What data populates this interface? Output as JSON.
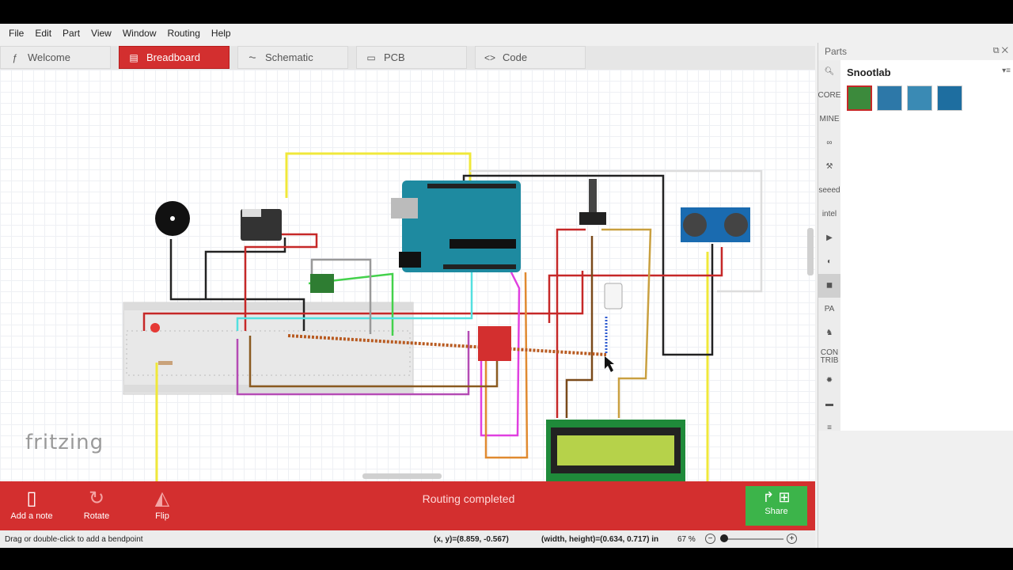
{
  "menu": [
    "File",
    "Edit",
    "Part",
    "View",
    "Window",
    "Routing",
    "Help"
  ],
  "tabs": [
    {
      "label": "Welcome",
      "icon": "f-icon"
    },
    {
      "label": "Breadboard",
      "icon": "breadboard-icon",
      "active": true
    },
    {
      "label": "Schematic",
      "icon": "schematic-icon"
    },
    {
      "label": "PCB",
      "icon": "pcb-icon"
    },
    {
      "label": "Code",
      "icon": "code-icon"
    }
  ],
  "canvas": {
    "logo_text": "fritzing"
  },
  "toolbar": {
    "add_note": "Add a note",
    "rotate": "Rotate",
    "flip": "Flip",
    "status": "Routing completed",
    "share": "Share"
  },
  "statusbar": {
    "hint": "Drag or double-click to add a bendpoint",
    "coords": "(x, y)=(8.859, -0.567)",
    "dims": "(width, height)=(0.634, 0.717) in",
    "zoom": "67 %"
  },
  "parts": {
    "title": "Parts",
    "bin_title": "Snootlab",
    "bins": [
      "CORE",
      "MINE",
      "∞",
      "⚒",
      "seeed",
      "intel",
      "▶",
      "◐",
      "◼",
      "PA",
      "♞",
      "CON TRIB",
      "✹",
      "▬",
      "≡"
    ]
  },
  "colors": {
    "accent": "#d32f2f",
    "share": "#3cb44a"
  }
}
